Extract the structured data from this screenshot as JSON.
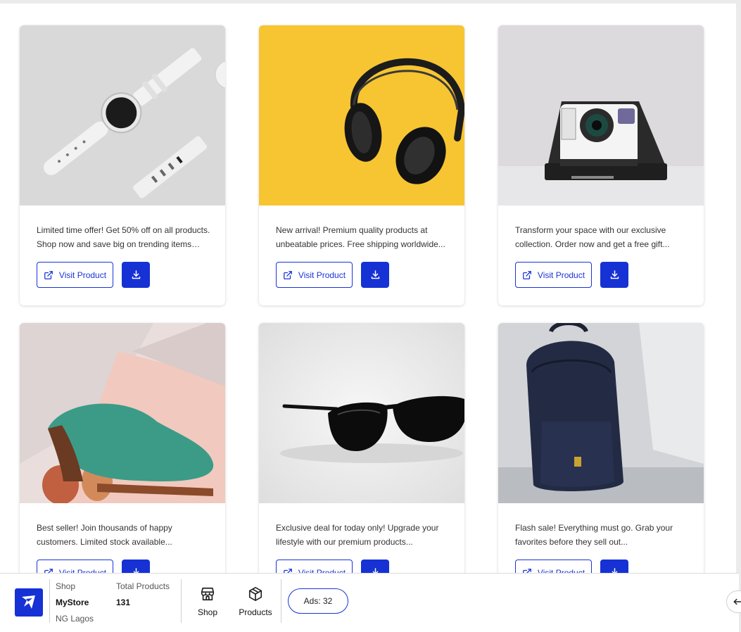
{
  "products": [
    {
      "description": "Limited time offer! Get 50% off on all products. Shop now and save big on trending items today...",
      "visit_label": "Visit Product",
      "image": "smartwatch"
    },
    {
      "description": "New arrival! Premium quality products at unbeatable prices. Free shipping worldwide...",
      "visit_label": "Visit Product",
      "image": "headphones"
    },
    {
      "description": "Transform your space with our exclusive collection. Order now and get a free gift...",
      "visit_label": "Visit Product",
      "image": "instant-camera"
    },
    {
      "description": "Best seller! Join thousands of happy customers. Limited stock available...",
      "visit_label": "Visit Product",
      "image": "green-shoe"
    },
    {
      "description": "Exclusive deal for today only! Upgrade your lifestyle with our premium products...",
      "visit_label": "Visit Product",
      "image": "sunglasses"
    },
    {
      "description": "Flash sale! Everything must go. Grab your favorites before they sell out...",
      "visit_label": "Visit Product",
      "image": "backpack"
    }
  ],
  "footer": {
    "shop_label": "Shop",
    "shop_name": "MyStore",
    "location": "NG Lagos",
    "total_label": "Total Products",
    "total_value": "131",
    "nav": [
      {
        "label": "Shop",
        "icon": "storefront-icon"
      },
      {
        "label": "Products",
        "icon": "box-icon"
      }
    ],
    "ads_label": "Ads: 32"
  },
  "colors": {
    "accent": "#1631d4",
    "card_bg": "#ffffff",
    "page_bg": "#ffffff"
  }
}
